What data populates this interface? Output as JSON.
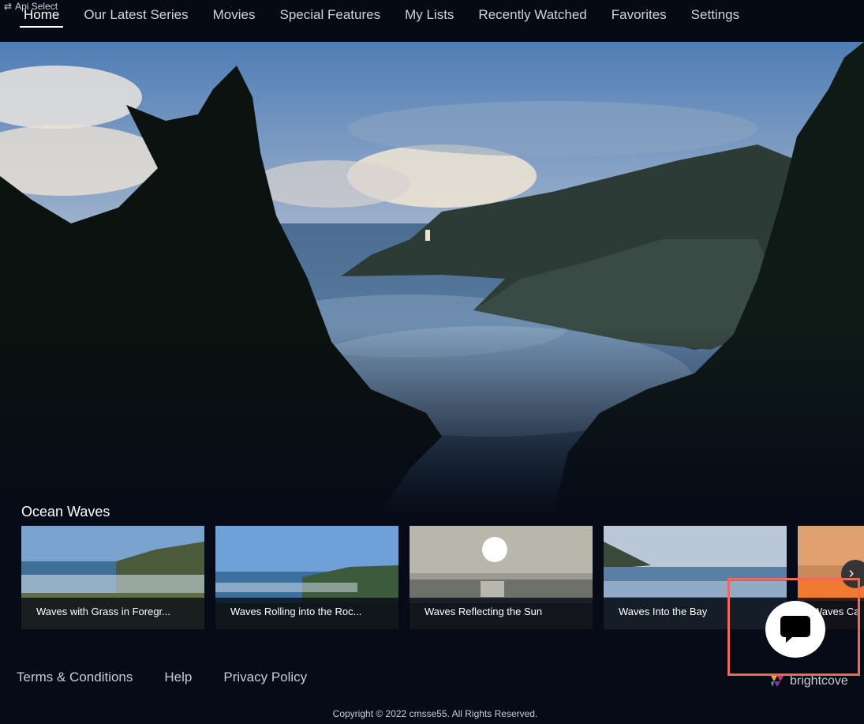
{
  "api_select": {
    "label": "Api Select",
    "icon": "swap-arrows-icon"
  },
  "nav": {
    "items": [
      {
        "label": "Home",
        "active": true
      },
      {
        "label": "Our Latest Series",
        "active": false
      },
      {
        "label": "Movies",
        "active": false
      },
      {
        "label": "Special Features",
        "active": false
      },
      {
        "label": "My Lists",
        "active": false
      },
      {
        "label": "Recently Watched",
        "active": false
      },
      {
        "label": "Favorites",
        "active": false
      },
      {
        "label": "Settings",
        "active": false
      }
    ]
  },
  "row": {
    "title": "Ocean Waves",
    "tiles": [
      {
        "caption": "Waves with Grass in Foregr..."
      },
      {
        "caption": "Waves Rolling into the Roc..."
      },
      {
        "caption": "Waves Reflecting the Sun"
      },
      {
        "caption": "Waves Into the Bay"
      },
      {
        "caption": "Waves Ca"
      }
    ],
    "next_icon": "chevron-right-icon"
  },
  "footer": {
    "links": [
      {
        "label": "Terms & Conditions"
      },
      {
        "label": "Help"
      },
      {
        "label": "Privacy Policy"
      }
    ],
    "brand": "brightcove",
    "copyright": "Copyright © 2022 cmsse55. All Rights Reserved."
  },
  "chat": {
    "icon": "chat-bubble-icon"
  },
  "colors": {
    "background": "#060b17",
    "highlight": "#f0675c",
    "text": "#ffffff"
  }
}
